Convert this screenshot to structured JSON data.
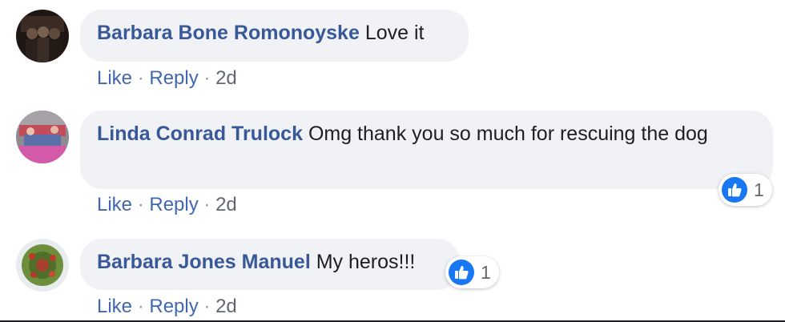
{
  "comments": [
    {
      "author": "Barbara Bone Romonoyske",
      "text": "Love it",
      "like_label": "Like",
      "reply_label": "Reply",
      "separator": "·",
      "time": "2d",
      "reaction_count": null
    },
    {
      "author": "Linda Conrad Trulock",
      "text": "Omg thank you so much for rescuing the dog",
      "like_label": "Like",
      "reply_label": "Reply",
      "separator": "·",
      "time": "2d",
      "reaction_count": "1"
    },
    {
      "author": "Barbara Jones Manuel",
      "text": "My heros!!!",
      "like_label": "Like",
      "reply_label": "Reply",
      "separator": "·",
      "time": "2d",
      "reaction_count": "1"
    }
  ],
  "icons": {
    "reaction": "thumbs-up-icon",
    "reaction_color": "#1877f2",
    "author_color": "#385898",
    "action_color": "#4267b2"
  }
}
